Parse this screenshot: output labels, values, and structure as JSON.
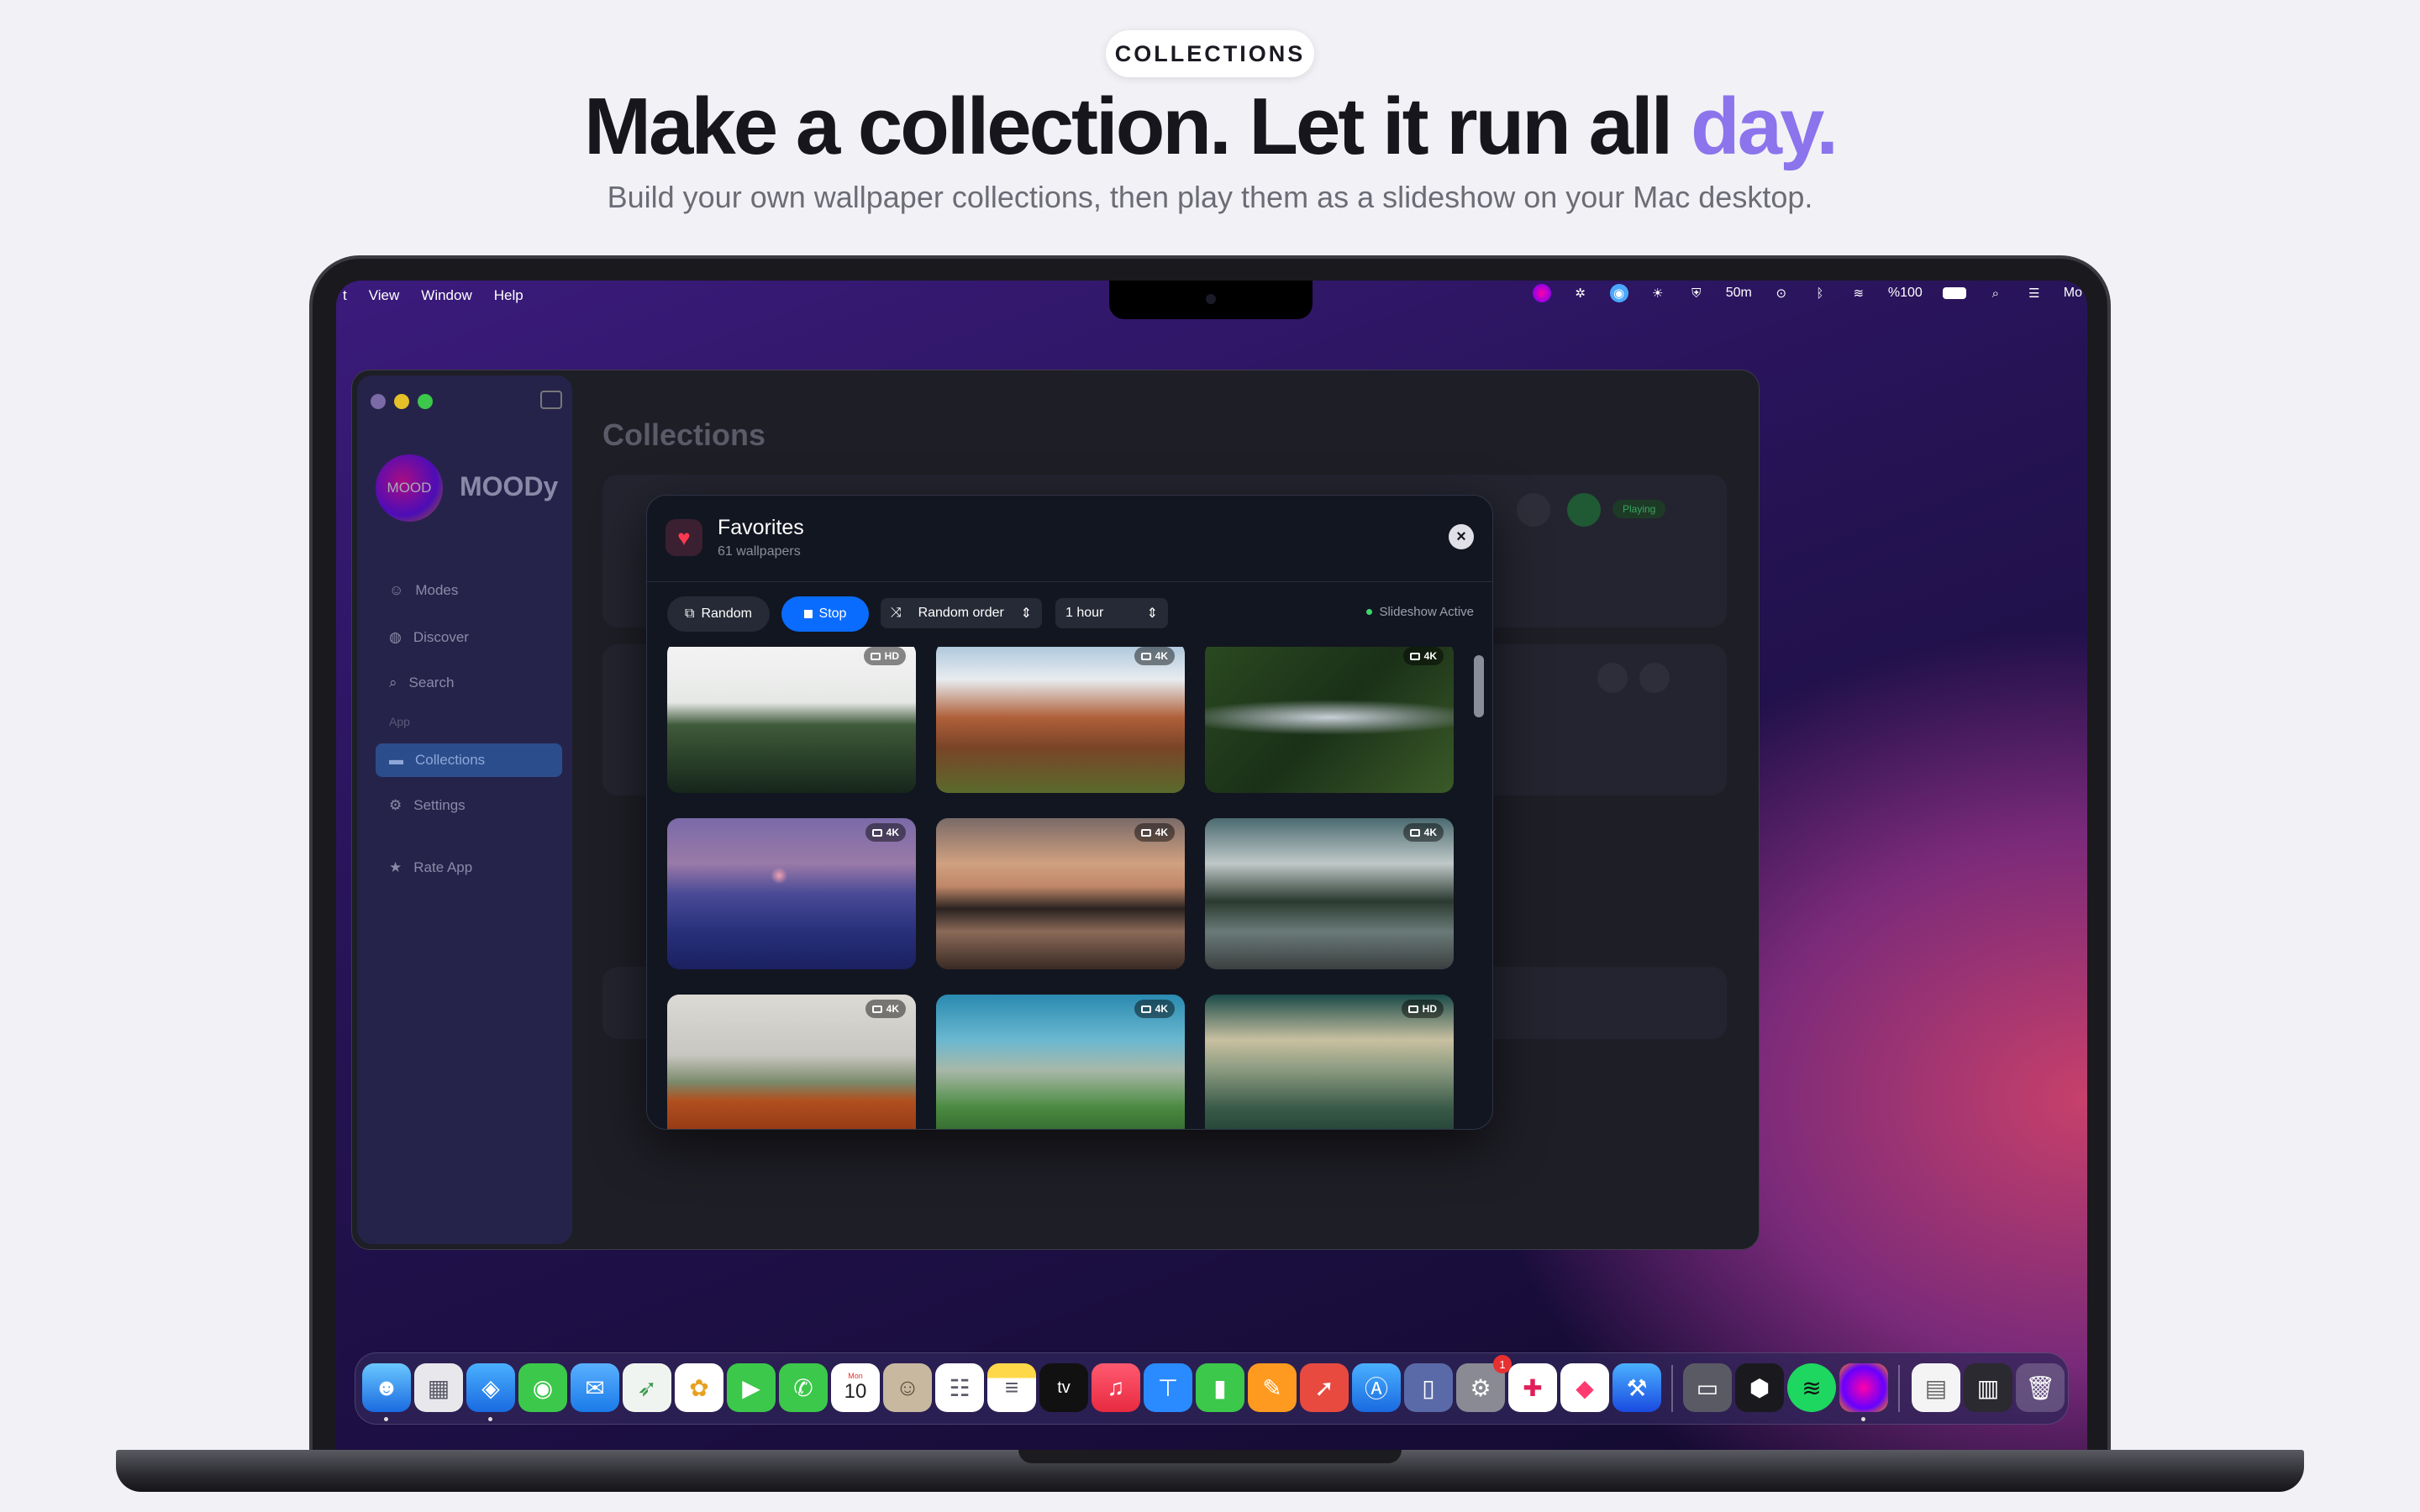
{
  "hero": {
    "pill": "COLLECTIONS",
    "headline_main": "Make a collection. Let it run all ",
    "headline_accent": "day.",
    "subtitle": "Build your own wallpaper collections, then play them as a slideshow on your Mac desktop."
  },
  "menubar": {
    "items": [
      "t",
      "View",
      "Window",
      "Help"
    ],
    "status": {
      "timer": "50m",
      "battery": "%100",
      "clock": "Mo"
    }
  },
  "app": {
    "logo_text": "MOOD",
    "name": "MOODy",
    "nav": [
      {
        "label": "Modes",
        "icon": "masks-icon"
      },
      {
        "label": "Discover",
        "icon": "compass-icon"
      },
      {
        "label": "Search",
        "icon": "search-icon"
      }
    ],
    "section_label": "App",
    "nav2": [
      {
        "label": "Collections",
        "icon": "folder-icon",
        "active": true
      },
      {
        "label": "Settings",
        "icon": "gear-icon"
      },
      {
        "label": "Rate App",
        "icon": "star-icon"
      }
    ],
    "page_title": "Collections",
    "bg_status": "Playing"
  },
  "modal": {
    "title": "Favorites",
    "subtitle": "61 wallpapers",
    "random_label": "Random",
    "stop_label": "Stop",
    "order_label": "Random order",
    "interval_label": "1 hour",
    "status": "Slideshow Active",
    "wallpapers": [
      {
        "badge": "HD",
        "scene": "pine-forest"
      },
      {
        "badge": "4K",
        "scene": "canyon"
      },
      {
        "badge": "4K",
        "scene": "river-aerial"
      },
      {
        "badge": "4K",
        "scene": "purple-sunset"
      },
      {
        "badge": "4K",
        "scene": "lake-dusk"
      },
      {
        "badge": "4K",
        "scene": "mountain-road"
      },
      {
        "badge": "4K",
        "scene": "tulip-field"
      },
      {
        "badge": "4K",
        "scene": "alpine-valley"
      },
      {
        "badge": "HD",
        "scene": "green-hills"
      }
    ]
  },
  "dock": {
    "calendar_month": "Mon",
    "calendar_day": "10",
    "notification_badge": "1",
    "tv_label": "tv"
  },
  "colors": {
    "accent": "#8b74ec",
    "stop_button": "#0a6cff",
    "active_nav": "#2c4d8c"
  }
}
